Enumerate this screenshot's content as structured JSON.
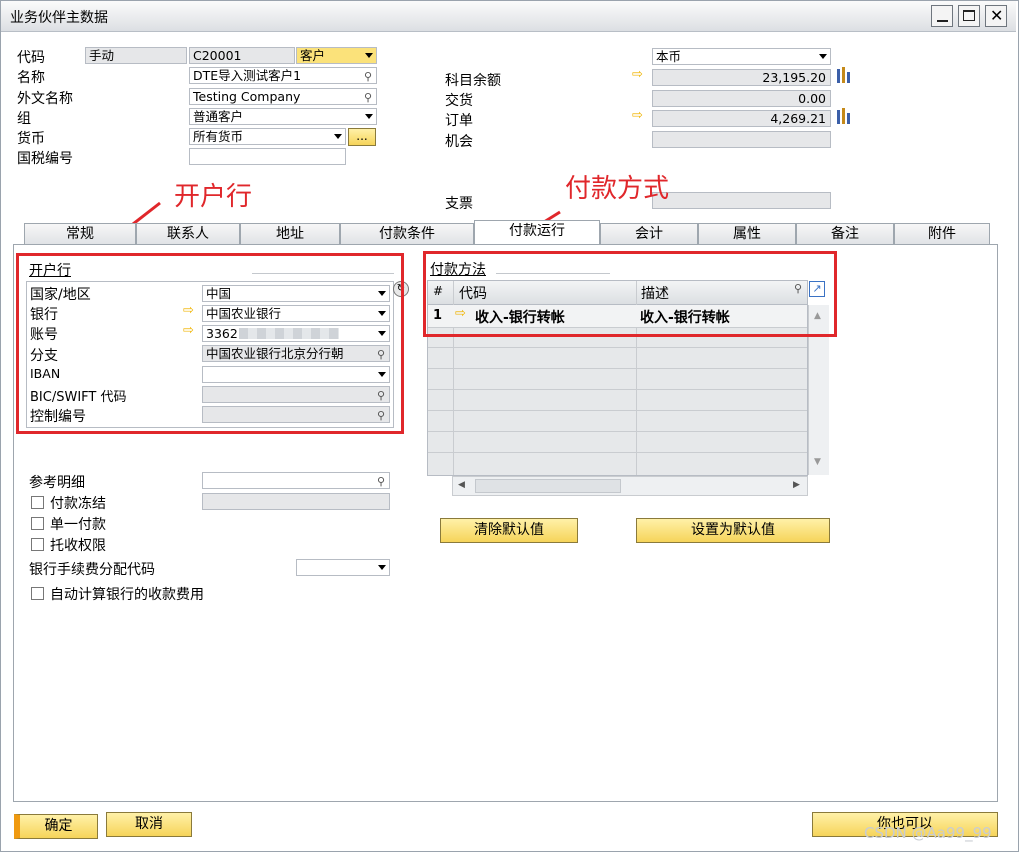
{
  "window": {
    "title": "业务伙伴主数据"
  },
  "header_left": {
    "code_label": "代码",
    "code_mode": "手动",
    "code_value": "C20001",
    "bp_type": "客户",
    "name_label": "名称",
    "name_value": "DTE导入测试客户1",
    "foreign_name_label": "外文名称",
    "foreign_name_value": "Testing Company",
    "group_label": "组",
    "group_value": "普通客户",
    "currency_label": "货币",
    "currency_value": "所有货币",
    "currency_btn": "...",
    "tax_label": "国税编号",
    "tax_value": ""
  },
  "header_right": {
    "currency_select": "本币",
    "balance_label": "科目余额",
    "balance_value": "23,195.20",
    "delivery_label": "交货",
    "delivery_value": "0.00",
    "orders_label": "订单",
    "orders_value": "4,269.21",
    "opportunity_label": "机会",
    "opportunity_value": "",
    "check_label": "支票",
    "check_value": ""
  },
  "annotations": {
    "bank": "开户行",
    "payment_method": "付款方式"
  },
  "tabs": [
    {
      "label": "常规"
    },
    {
      "label": "联系人"
    },
    {
      "label": "地址"
    },
    {
      "label": "付款条件"
    },
    {
      "label": "付款运行"
    },
    {
      "label": "会计"
    },
    {
      "label": "属性"
    },
    {
      "label": "备注"
    },
    {
      "label": "附件"
    }
  ],
  "bank_section": {
    "title": "开户行",
    "rows": [
      {
        "label": "国家/地区",
        "value": "中国"
      },
      {
        "label": "银行",
        "value": "中国农业银行"
      },
      {
        "label": "账号",
        "value": "3362"
      },
      {
        "label": "分支",
        "value": "中国农业银行北京分行朝"
      },
      {
        "label": "IBAN",
        "value": ""
      },
      {
        "label": "BIC/SWIFT 代码",
        "value": ""
      },
      {
        "label": "控制编号",
        "value": ""
      }
    ]
  },
  "payment_section": {
    "title": "付款方法",
    "col_hash": "#",
    "col_code": "代码",
    "col_desc": "描述",
    "rows": [
      {
        "num": "1",
        "code": "收入-银行转帐",
        "desc": "收入-银行转帐"
      }
    ],
    "clear_default_btn": "清除默认值",
    "set_default_btn": "设置为默认值"
  },
  "lower_section": {
    "ref_detail_label": "参考明细",
    "ref_detail_value": "",
    "payment_block_label": "付款冻结",
    "single_payment_label": "单一付款",
    "collection_auth_label": "托收权限",
    "bank_charge_label": "银行手续费分配代码",
    "bank_charge_value": "",
    "auto_calc_label": "自动计算银行的收款费用"
  },
  "footer": {
    "ok_btn": "确定",
    "cancel_btn": "取消",
    "also_btn": "你也可以"
  },
  "watermark": "CSDN @Aa99_99"
}
